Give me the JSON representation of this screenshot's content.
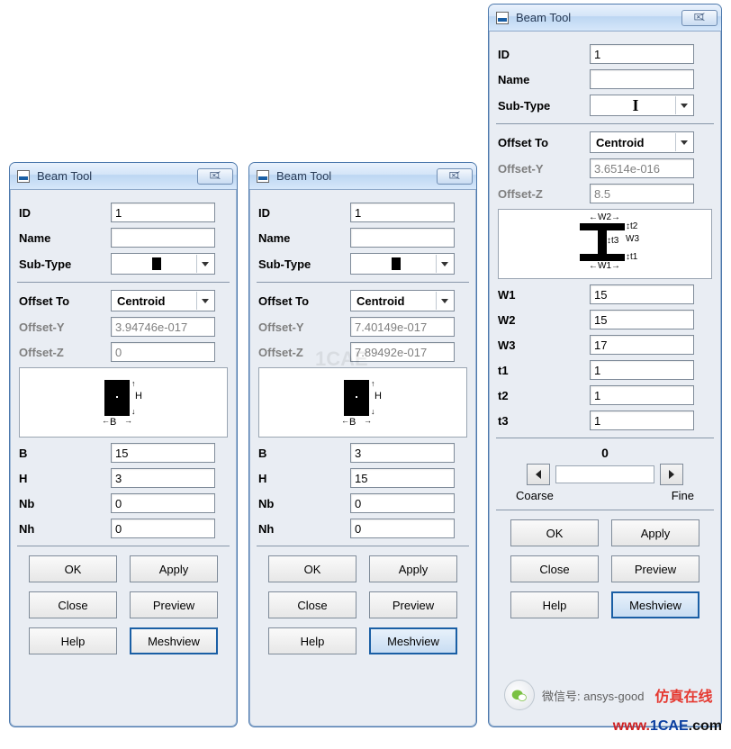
{
  "common": {
    "window_title": "Beam Tool",
    "labels": {
      "id": "ID",
      "name": "Name",
      "sub_type": "Sub-Type",
      "offset_to": "Offset To",
      "offset_y": "Offset-Y",
      "offset_z": "Offset-Z",
      "B": "B",
      "H": "H",
      "Nb": "Nb",
      "Nh": "Nh",
      "W1": "W1",
      "W2": "W2",
      "W3": "W3",
      "t1": "t1",
      "t2": "t2",
      "t3": "t3",
      "coarse": "Coarse",
      "fine": "Fine",
      "ok": "OK",
      "apply": "Apply",
      "close": "Close",
      "preview": "Preview",
      "help": "Help",
      "meshview": "Meshview",
      "zero": "0",
      "subtype_rect": "■",
      "subtype_ibeam": "I",
      "offset_centroid": "Centroid"
    }
  },
  "dlg1": {
    "id": "1",
    "name": "",
    "sub_type": "rect",
    "offset_to": "Centroid",
    "offset_y": "3.94746e-017",
    "offset_z": "0",
    "B": "15",
    "H": "3",
    "Nb": "0",
    "Nh": "0"
  },
  "dlg2": {
    "id": "1",
    "name": "",
    "sub_type": "rect",
    "offset_to": "Centroid",
    "offset_y": "7.40149e-017",
    "offset_z": "7.89492e-017",
    "B": "3",
    "H": "15",
    "Nb": "0",
    "Nh": "0"
  },
  "dlg3": {
    "id": "1",
    "name": "",
    "sub_type": "ibeam",
    "offset_to": "Centroid",
    "offset_y": "3.6514e-016",
    "offset_z": "8.5",
    "W1": "15",
    "W2": "15",
    "W3": "17",
    "t1": "1",
    "t2": "1",
    "t3": "1",
    "slider": "0"
  },
  "watermark": {
    "cae": "1CAE",
    "wx": "微信号: ansys-good",
    "cn": "仿真在线",
    "url_www": "www.",
    "url_1cae": "1CAE",
    "url_com": ".com"
  },
  "diagram": {
    "H": "H",
    "B": "B",
    "w1": "W1",
    "w2": "W2",
    "w3": "W3",
    "t1": "t1",
    "t2": "t2",
    "t3": "t3"
  }
}
